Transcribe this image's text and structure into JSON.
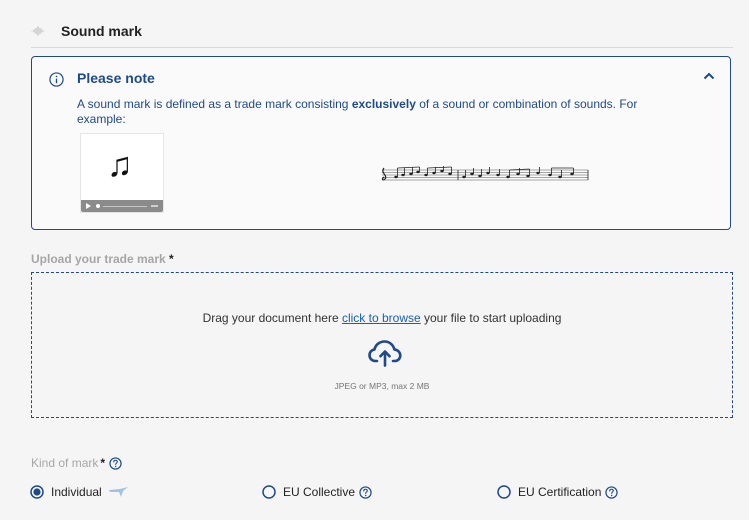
{
  "section": {
    "title": "Sound mark",
    "icon": "sound-wave-icon"
  },
  "note": {
    "title": "Please note",
    "text_before": "A sound mark is defined as a trade mark consisting ",
    "text_bold": "exclusively",
    "text_after": " of a sound or combination of sounds. For example:",
    "icon": "info-icon",
    "toggle_icon": "chevron-up-icon",
    "example_audio_icon": "music-note-icon",
    "example_score_icon": "sheet-music-icon"
  },
  "upload": {
    "label": "Upload your trade mark",
    "required_mark": "*",
    "drag_before": "Drag your document here ",
    "browse_link": "click to browse",
    "drag_after": " your file to start uploading",
    "formats": "JPEG or MP3, max 2 MB",
    "icon": "cloud-upload-icon"
  },
  "kind": {
    "label": "Kind of mark",
    "required_mark": "*",
    "options": [
      {
        "label": "Individual",
        "selected": true
      },
      {
        "label": "EU Collective",
        "selected": false
      },
      {
        "label": "EU Certification",
        "selected": false
      }
    ]
  },
  "colors": {
    "accent": "#1f4a8a",
    "link": "#1a5fb4",
    "muted": "#a6a6a6"
  }
}
